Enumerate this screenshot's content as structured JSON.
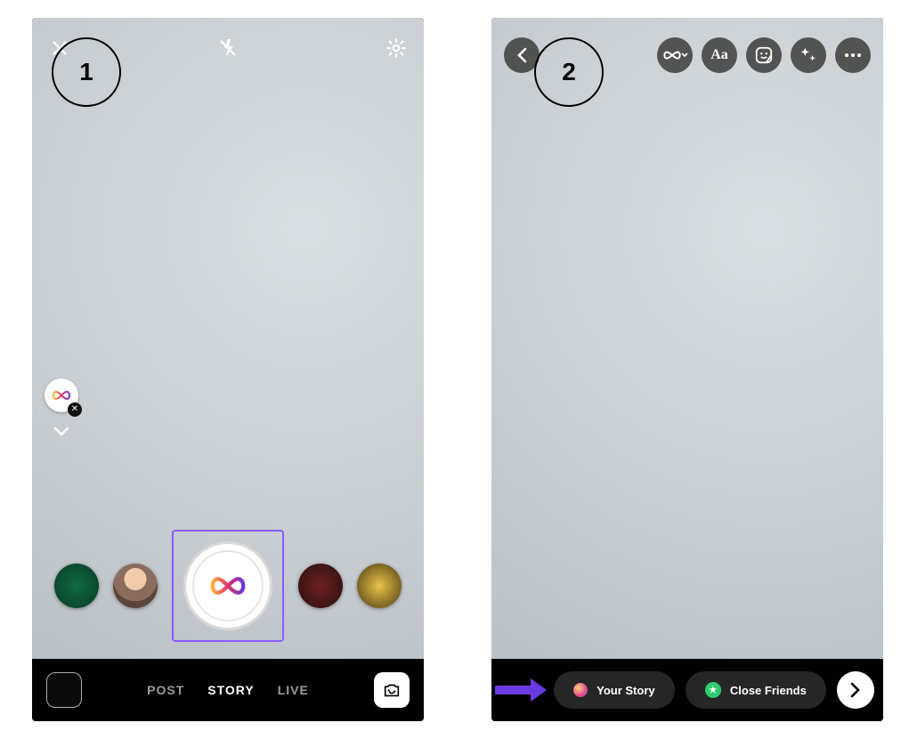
{
  "steps": {
    "one": "1",
    "two": "2"
  },
  "screen1": {
    "modes": {
      "post": "POST",
      "story": "STORY",
      "live": "LIVE"
    },
    "active_mode": "story",
    "effects": {
      "boomerang": "∞"
    },
    "icons": {
      "close": "close",
      "flash": "flash-off",
      "settings": "gear",
      "swap": "camera-swap",
      "chevron": "chevron-down"
    }
  },
  "screen2": {
    "toolbar": {
      "boomerang": "∞",
      "text": "Aa",
      "sticker": "sticker",
      "sparkle": "sparkle",
      "more": "…"
    },
    "share": {
      "your_story": "Your Story",
      "close_friends": "Close Friends"
    },
    "icons": {
      "back": "chevron-left",
      "send": "chevron-right"
    }
  }
}
